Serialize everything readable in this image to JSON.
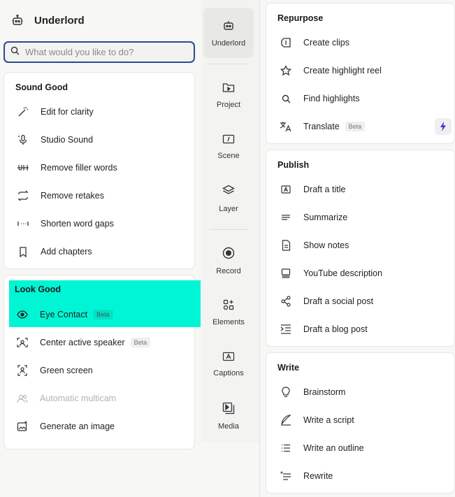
{
  "app": {
    "title": "Underlord"
  },
  "search": {
    "placeholder": "What would you like to do?"
  },
  "sound_good": {
    "title": "Sound Good",
    "items": [
      {
        "label": "Edit for clarity",
        "icon": "magic-wand-icon"
      },
      {
        "label": "Studio Sound",
        "icon": "microphone-sparkle-icon"
      },
      {
        "label": "Remove filler words",
        "icon": "strikethrough-uh-icon"
      },
      {
        "label": "Remove retakes",
        "icon": "repeat-arrows-icon"
      },
      {
        "label": "Shorten word gaps",
        "icon": "gap-icon"
      },
      {
        "label": "Add chapters",
        "icon": "bookmark-icon"
      }
    ]
  },
  "look_good": {
    "title": "Look Good",
    "items": [
      {
        "label": "Eye Contact",
        "badge": "Beta",
        "icon": "eye-icon"
      },
      {
        "label": "Center active speaker",
        "badge": "Beta",
        "icon": "speaker-focus-icon"
      },
      {
        "label": "Green screen",
        "icon": "green-screen-icon"
      },
      {
        "label": "Automatic multicam",
        "icon": "people-icon",
        "disabled": true
      },
      {
        "label": "Generate an image",
        "icon": "image-sparkle-icon"
      }
    ]
  },
  "nav": [
    {
      "label": "Underlord",
      "icon": "robot-icon",
      "active": true
    },
    {
      "label": "Project",
      "icon": "folder-icon"
    },
    {
      "label": "Scene",
      "icon": "scene-icon"
    },
    {
      "label": "Layer",
      "icon": "layers-icon"
    },
    {
      "label": "Record",
      "icon": "record-icon"
    },
    {
      "label": "Elements",
      "icon": "elements-icon"
    },
    {
      "label": "Captions",
      "icon": "captions-icon"
    },
    {
      "label": "Media",
      "icon": "media-icon"
    }
  ],
  "repurpose": {
    "title": "Repurpose",
    "items": [
      {
        "label": "Create clips",
        "icon": "clips-icon"
      },
      {
        "label": "Create highlight reel",
        "icon": "star-icon"
      },
      {
        "label": "Find highlights",
        "icon": "search-icon"
      },
      {
        "label": "Translate",
        "badge": "Beta",
        "icon": "translate-icon"
      }
    ]
  },
  "publish": {
    "title": "Publish",
    "items": [
      {
        "label": "Draft a title",
        "icon": "title-icon"
      },
      {
        "label": "Summarize",
        "icon": "lines-icon"
      },
      {
        "label": "Show notes",
        "icon": "document-icon"
      },
      {
        "label": "YouTube description",
        "icon": "description-icon"
      },
      {
        "label": "Draft a social post",
        "icon": "share-icon"
      },
      {
        "label": "Draft a blog post",
        "icon": "indent-icon"
      }
    ]
  },
  "write": {
    "title": "Write",
    "items": [
      {
        "label": "Brainstorm",
        "icon": "lightbulb-icon"
      },
      {
        "label": "Write a script",
        "icon": "quill-icon"
      },
      {
        "label": "Write an outline",
        "icon": "list-icon"
      },
      {
        "label": "Rewrite",
        "icon": "rewrite-icon"
      }
    ]
  },
  "colors": {
    "highlight": "#00f5d4",
    "search_border": "#2a4b8d",
    "accent": "#4b2fe0"
  }
}
